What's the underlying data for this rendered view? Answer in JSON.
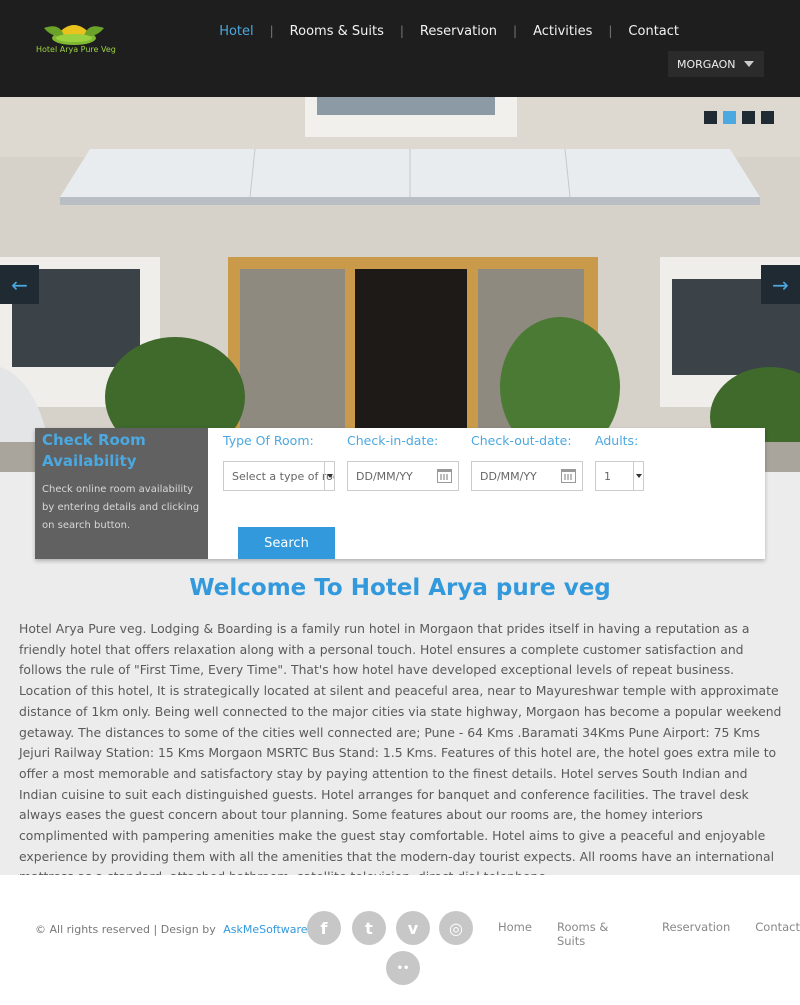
{
  "brand": {
    "logo_text": "Hotel Arya Pure Veg"
  },
  "nav": {
    "items": [
      {
        "label": "Hotel",
        "active": true
      },
      {
        "label": "Rooms & Suits"
      },
      {
        "label": "Reservation"
      },
      {
        "label": "Activities"
      },
      {
        "label": "Contact"
      }
    ],
    "separator": "|",
    "location": "MORGAON"
  },
  "slider": {
    "slides": 4,
    "active_slide": 2
  },
  "booking": {
    "title": "Check Room Availability",
    "description": "Check online room availability by entering details and clicking on search button.",
    "room_type_label": "Type Of Room:",
    "room_type_placeholder": "Select a type of room",
    "checkin_label": "Check-in-date:",
    "checkin_placeholder": "DD/MM/YY",
    "checkout_label": "Check-out-date:",
    "checkout_placeholder": "DD/MM/YY",
    "adults_label": "Adults:",
    "adults_value": "1",
    "search_label": "Search"
  },
  "welcome": {
    "title": "Welcome To Hotel Arya pure veg",
    "text": "Hotel Arya Pure veg. Lodging & Boarding is a family run hotel in Morgaon that prides itself in having a reputation as a friendly hotel that offers relaxation along with a personal touch. Hotel ensures a complete customer satisfaction and follows the rule of \"First Time, Every Time\". That's how hotel have developed exceptional levels of repeat business. Location of this hotel, It is strategically located at silent and peaceful area, near to Mayureshwar temple with approximate distance of 1km only. Being well connected to the major cities via state highway, Morgaon has become a popular weekend getaway. The distances to some of the cities well connected are; Pune - 64 Kms .Baramati 34Kms Pune Airport: 75 Kms Jejuri Railway Station: 15 Kms Morgaon MSRTC Bus Stand: 1.5 Kms. Features of this hotel are, the hotel goes extra mile to offer a most memorable and satisfactory stay by paying attention to the finest details. Hotel serves South Indian and Indian cuisine to suit each distinguished guests. Hotel arranges for banquet and conference facilities. The travel desk always eases the guest concern about tour planning. Some features about our rooms are, the homey interiors complimented with pampering amenities make the guest stay comfortable. Hotel aims to give a peaceful and enjoyable experience by providing them with all the amenities that the modern-day tourist expects. All rooms have an international mattress as a standard, attached bathroom, satellite television, direct dial telephone."
  },
  "footer": {
    "copyright": "© All rights reserved | Design by",
    "designer": "AskMeSoftware",
    "social": [
      {
        "icon": "facebook-icon",
        "glyph": "f"
      },
      {
        "icon": "twitter-icon",
        "glyph": "t"
      },
      {
        "icon": "vimeo-icon",
        "glyph": "v"
      },
      {
        "icon": "dribbble-icon",
        "glyph": "◎"
      },
      {
        "icon": "flickr-icon",
        "glyph": "••"
      }
    ],
    "links": [
      "Home",
      "Rooms & Suits",
      "Reservation",
      "Contact"
    ]
  },
  "colors": {
    "accent": "#3399dd",
    "header_bg": "#1e1e1e",
    "panel_bg": "#616161",
    "page_bg": "#ececec"
  }
}
